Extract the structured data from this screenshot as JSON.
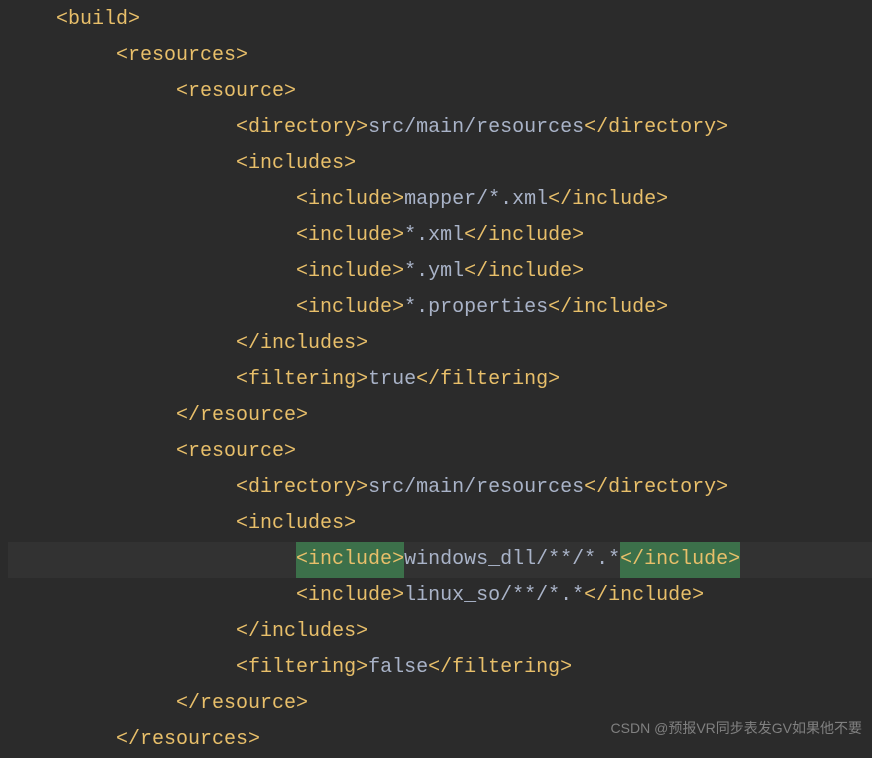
{
  "lines": [
    {
      "indent": 0,
      "open": "build",
      "close": "",
      "mid": ""
    },
    {
      "indent": 1,
      "open": "resources",
      "close": "",
      "mid": ""
    },
    {
      "indent": 2,
      "open": "resource",
      "close": "",
      "mid": ""
    },
    {
      "indent": 3,
      "open": "directory",
      "close": "directory",
      "mid": "src/main/resources"
    },
    {
      "indent": 3,
      "open": "includes",
      "close": "",
      "mid": ""
    },
    {
      "indent": 4,
      "open": "include",
      "close": "include",
      "mid": "mapper/*.xml"
    },
    {
      "indent": 4,
      "open": "include",
      "close": "include",
      "mid": "*.xml"
    },
    {
      "indent": 4,
      "open": "include",
      "close": "include",
      "mid": "*.yml"
    },
    {
      "indent": 4,
      "open": "include",
      "close": "include",
      "mid": "*.properties"
    },
    {
      "indent": 3,
      "open": "",
      "close": "includes",
      "mid": ""
    },
    {
      "indent": 3,
      "open": "filtering",
      "close": "filtering",
      "mid": "true"
    },
    {
      "indent": 2,
      "open": "",
      "close": "resource",
      "mid": ""
    },
    {
      "indent": 2,
      "open": "resource",
      "close": "",
      "mid": ""
    },
    {
      "indent": 3,
      "open": "directory",
      "close": "directory",
      "mid": "src/main/resources"
    },
    {
      "indent": 3,
      "open": "includes",
      "close": "",
      "mid": ""
    },
    {
      "indent": 4,
      "open": "include",
      "close": "include",
      "mid": "windows_dll/**/*.*",
      "highlighted": true,
      "selected": true
    },
    {
      "indent": 4,
      "open": "include",
      "close": "include",
      "mid": "linux_so/**/*.*"
    },
    {
      "indent": 3,
      "open": "",
      "close": "includes",
      "mid": ""
    },
    {
      "indent": 3,
      "open": "filtering",
      "close": "filtering",
      "mid": "false"
    },
    {
      "indent": 2,
      "open": "",
      "close": "resource",
      "mid": ""
    },
    {
      "indent": 1,
      "open": "",
      "close": "resources",
      "mid": ""
    }
  ],
  "watermark": "CSDN @预报VR同步表发GV如果他不要"
}
